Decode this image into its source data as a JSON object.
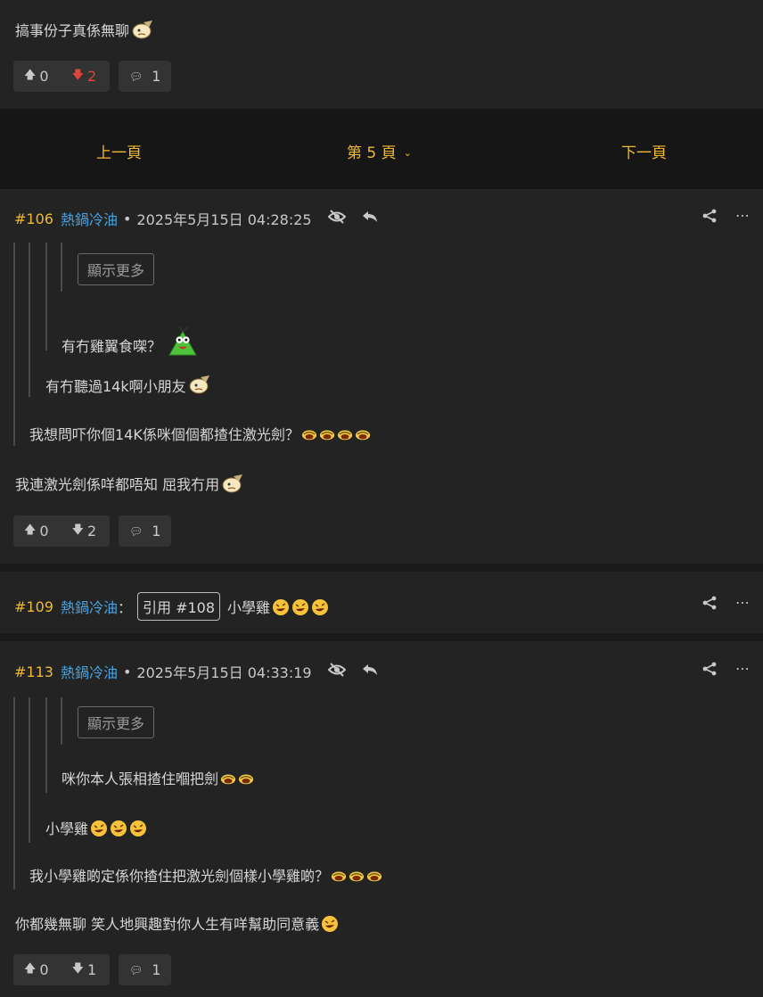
{
  "top_post": {
    "body": "搞事份子真係無聊",
    "votes": {
      "up": "0",
      "down": "2",
      "comments": "1"
    }
  },
  "pager": {
    "prev": "上一頁",
    "current": "第 5 頁",
    "next": "下一頁"
  },
  "post106": {
    "id": "#106",
    "user": "熱鍋冷油",
    "sep": "•",
    "date": "2025年5月15日 04:28:25",
    "show_more": "顯示更多",
    "q3": "有冇雞翼食㗎？",
    "q2": "有冇聽過14k啊小朋友",
    "q1": "我想問吓你個14K係咪個個都揸住激光劍？",
    "body": "我連激光劍係咩都唔知 屈我冇用",
    "votes": {
      "up": "0",
      "down": "2",
      "comments": "1"
    }
  },
  "post109": {
    "id": "#109",
    "user": "熱鍋冷油",
    "colon": "：",
    "quote_chip": "引用 #108",
    "body": "小學雞"
  },
  "post113": {
    "id": "#113",
    "user": "熱鍋冷油",
    "sep": "•",
    "date": "2025年5月15日 04:33:19",
    "show_more": "顯示更多",
    "q3": "咪你本人張相揸住嗰把劍",
    "q2": "小學雞",
    "q1": "我小學雞啲定係你揸住把激光劍個樣小學雞啲？",
    "body": "你都幾無聊 笑人地興趣對你人生有咩幫助同意義",
    "votes": {
      "up": "0",
      "down": "1",
      "comments": "1"
    }
  },
  "colors": {
    "accent": "#f1b930",
    "username": "#4aa3df",
    "downvote_active": "#e0443a"
  },
  "icons": [
    "thumb-up-icon",
    "thumb-down-icon",
    "comment-icon",
    "chevron-down-icon",
    "hide-icon",
    "reply-icon",
    "share-icon",
    "more-icon",
    "laugh-emoji-icon",
    "facepalm-emoji-icon",
    "rolling-laugh-emoji-icon"
  ]
}
